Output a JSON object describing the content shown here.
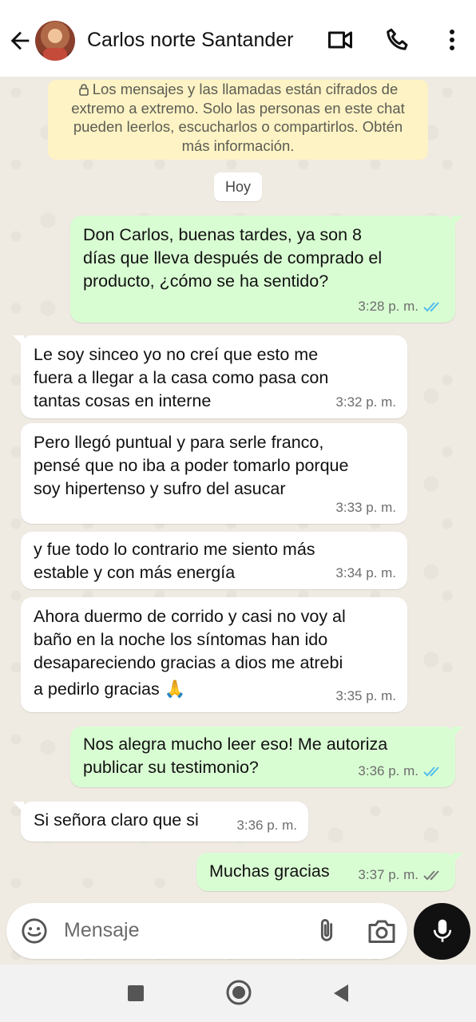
{
  "header": {
    "contact_name": "Carlos norte Santander",
    "icons": [
      "back-arrow-icon",
      "avatar",
      "video-call-icon",
      "phone-icon",
      "more-menu-icon"
    ]
  },
  "notice": {
    "text_lines": [
      "Los mensajes y las llamadas están cifrados de",
      "extremo a extremo. Solo las personas en este chat",
      "pueden leerlos, escucharlos o compartirlos. Obtén",
      "más información."
    ]
  },
  "day_label": "Hoy",
  "messages": [
    {
      "dir": "out",
      "lines": [
        "Don Carlos, buenas tardes, ya son 8",
        "días que lleva después de comprado el",
        "producto, ¿cómo se ha sentido?"
      ],
      "time": "3:28 p. m.",
      "status": "read"
    },
    {
      "dir": "in",
      "lines": [
        "Le soy sinceo yo no creí que esto me",
        "fuera a llegar a la casa como pasa con",
        "tantas cosas en interne"
      ],
      "time": "3:32 p. m."
    },
    {
      "dir": "in",
      "lines": [
        "Pero llegó puntual y para serle franco,",
        "pensé que no iba a poder tomarlo porque",
        "soy hipertenso y sufro del asucar"
      ],
      "time": "3:33 p. m."
    },
    {
      "dir": "in",
      "lines": [
        "y fue todo lo contrario me siento más",
        "estable y con más energía"
      ],
      "time": "3:34 p. m."
    },
    {
      "dir": "in",
      "lines": [
        "Ahora duermo de corrido y casi no voy al",
        "baño en la noche los síntomas han ido",
        "desapareciendo gracias a dios me atrebi",
        "a pedirlo gracias 🙏"
      ],
      "time": "3:35 p. m."
    },
    {
      "dir": "out",
      "lines": [
        "Nos alegra mucho leer eso! Me autoriza",
        "publicar su testimonio?"
      ],
      "time": "3:36 p. m.",
      "status": "read"
    },
    {
      "dir": "in",
      "lines": [
        "Si señora claro que si"
      ],
      "time": "3:36 p. m."
    },
    {
      "dir": "out",
      "lines": [
        "Muchas gracias"
      ],
      "time": "3:37 p. m.",
      "status": "delivered"
    }
  ],
  "composer": {
    "placeholder": "Mensaje"
  },
  "colors": {
    "outgoing_bubble": "#d9fdd3",
    "incoming_bubble": "#ffffff",
    "chat_bg": "#efeae2",
    "read_ticks": "#53bdeb",
    "notice_bg": "#fdf3c4"
  }
}
